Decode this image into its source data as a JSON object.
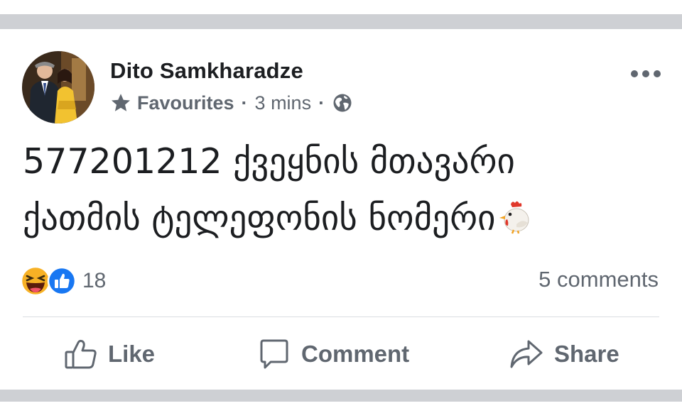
{
  "post": {
    "author": "Dito Samkharadze",
    "audience": "Favourites",
    "separator": "·",
    "time": "3 mins",
    "body_line1": "577201212 ქვეყნის მთავარი",
    "body_line2": "ქათმის ტელეფონის ნომერი",
    "emoji": "chicken-emoji"
  },
  "reactions": {
    "types": [
      "haha",
      "like"
    ],
    "count": "18"
  },
  "comments": {
    "label": "5 comments"
  },
  "actions": {
    "like": "Like",
    "comment": "Comment",
    "share": "Share"
  },
  "icons": [
    "star-icon",
    "globe-icon",
    "more-options-icon",
    "thumbs-up-icon",
    "comment-bubble-icon",
    "share-arrow-icon"
  ],
  "colors": {
    "text": "#1c1e21",
    "secondary_text": "#606770",
    "separator_bar": "#ced0d4",
    "like_blue": "#1877f2",
    "haha_yellow": "#f7b125"
  }
}
